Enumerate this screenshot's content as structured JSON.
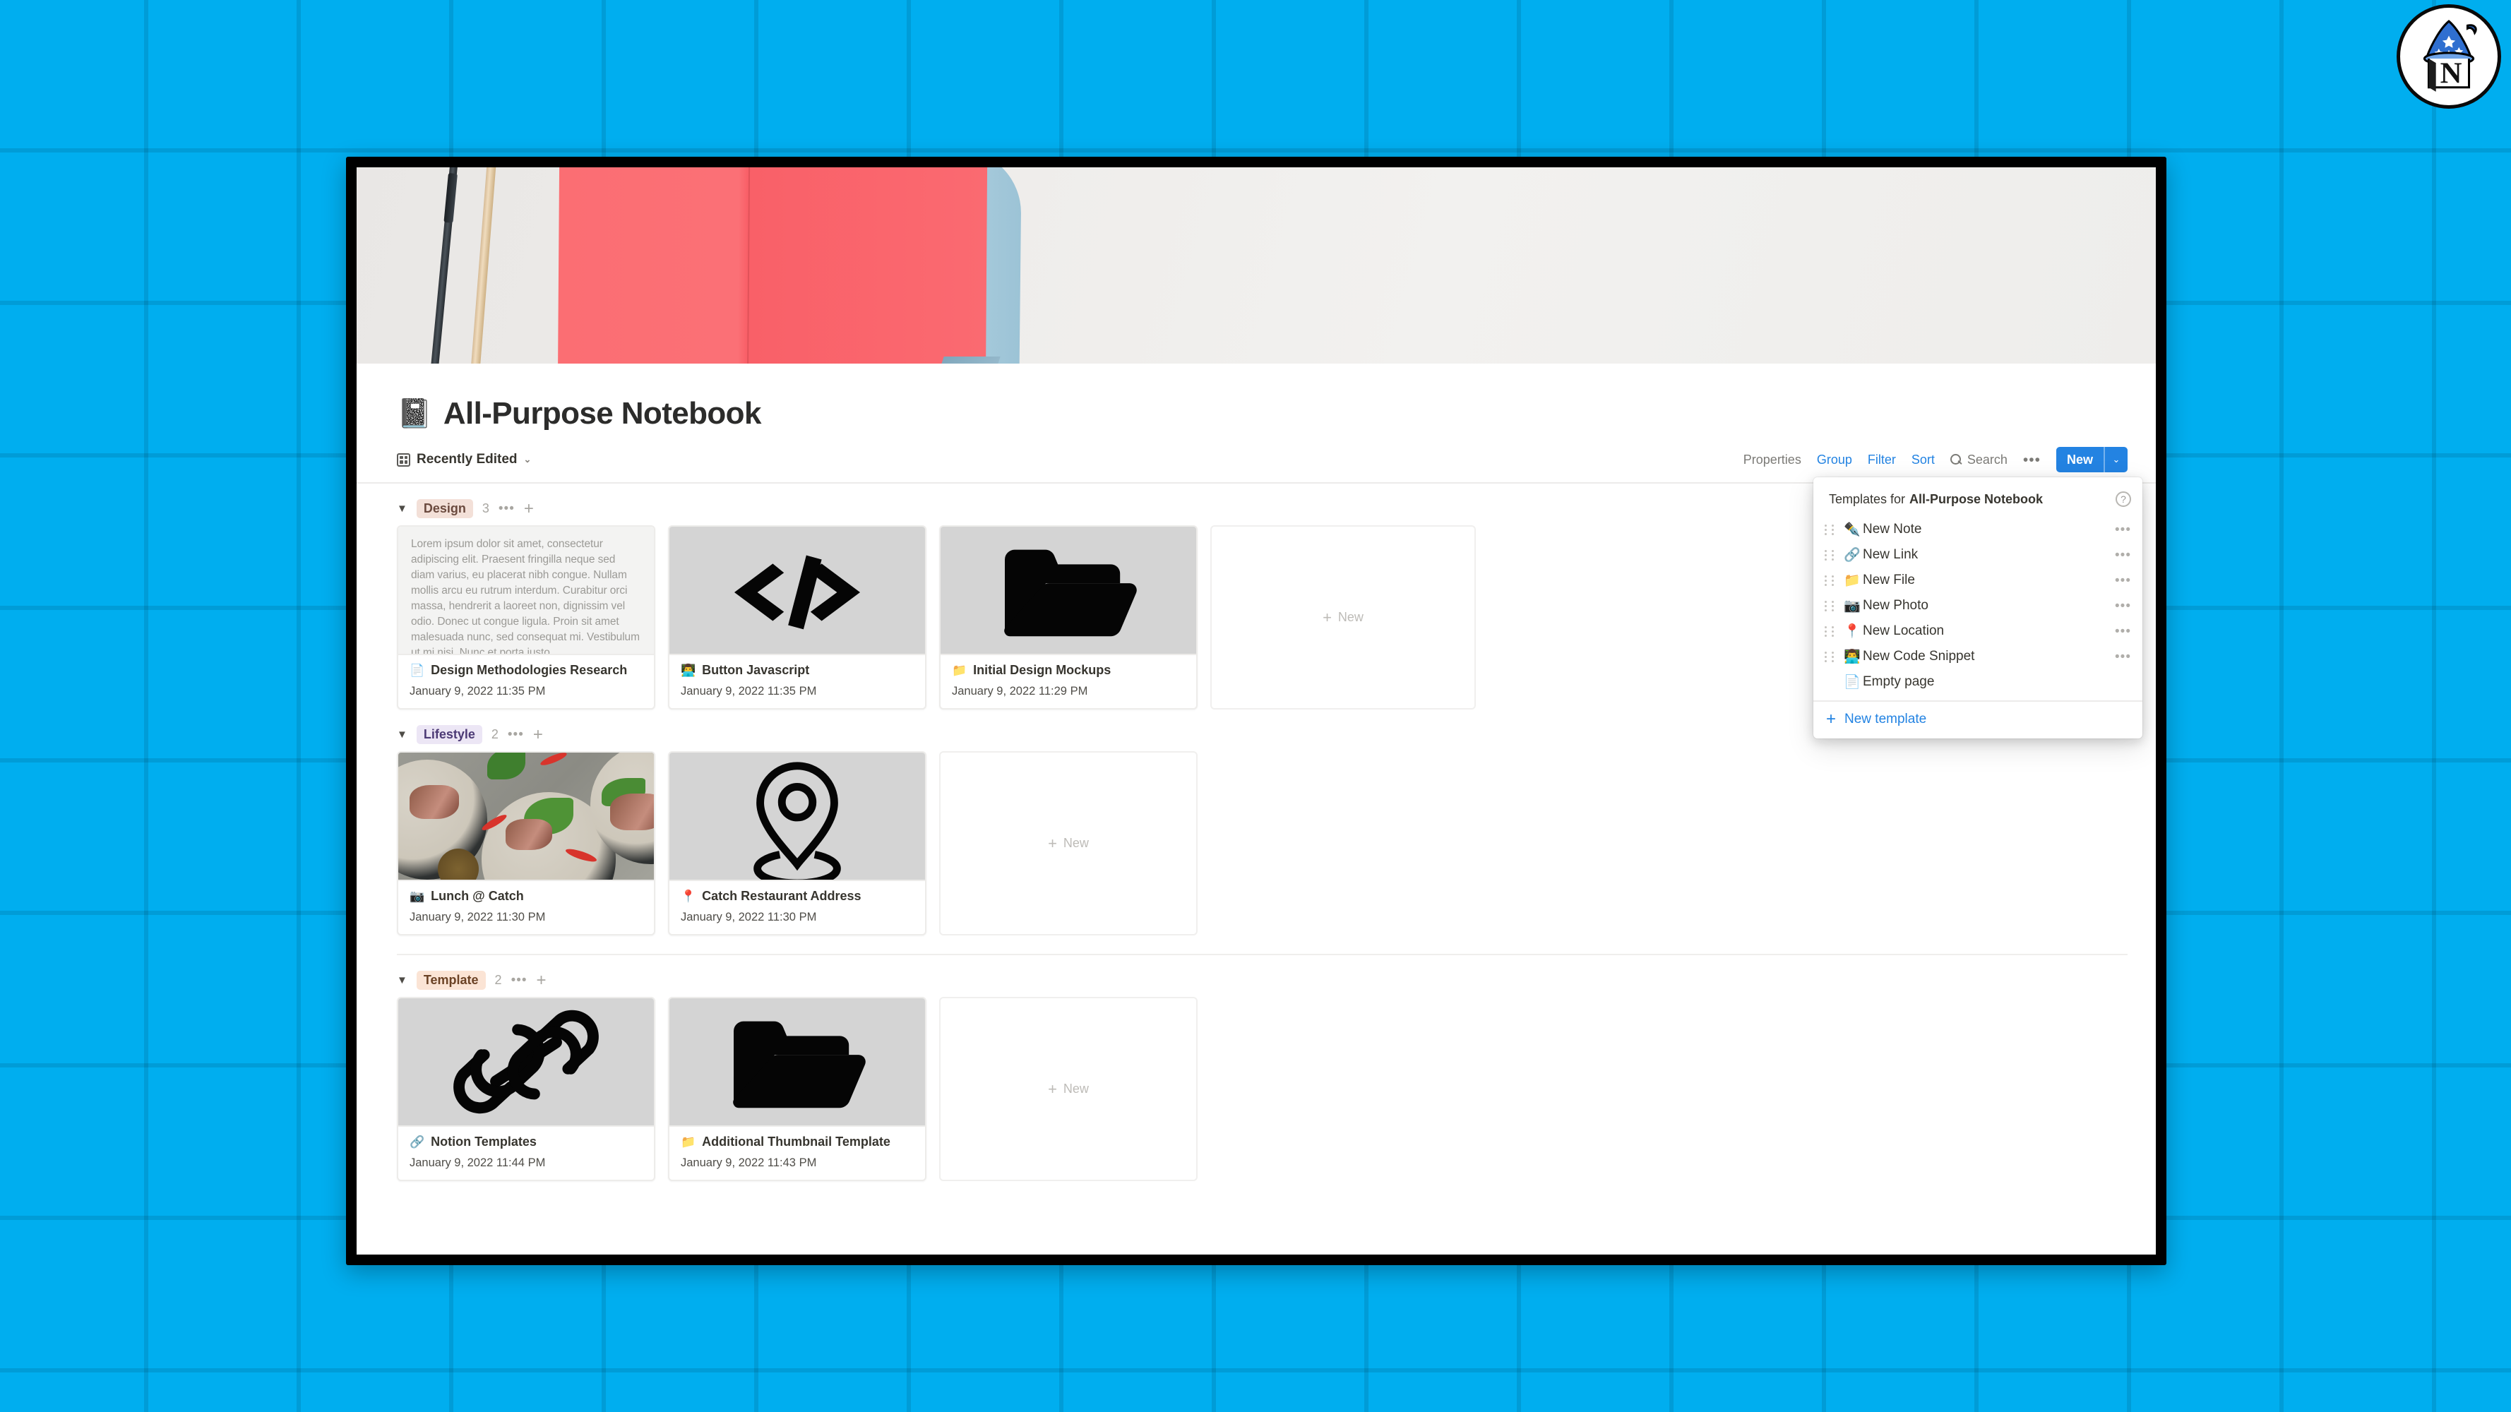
{
  "background": {
    "color": "#00AEEF",
    "grid_line_color": "rgba(0,0,0,0.10)"
  },
  "logo": {
    "name": "notion-wizard-logo",
    "letter": "N"
  },
  "cover": {
    "alt": "pink notebook with pen and pencil on light gray desk"
  },
  "page": {
    "emoji": "📓",
    "title": "All-Purpose Notebook"
  },
  "view_bar": {
    "current_view": "Recently Edited",
    "view_caret": "⌄",
    "actions": {
      "properties": "Properties",
      "group": "Group",
      "filter": "Filter",
      "sort": "Sort",
      "search": "Search",
      "more": "•••",
      "new_button": "New",
      "new_caret": "⌄"
    },
    "accent_color": "#2383e2"
  },
  "groups": [
    {
      "name": "Design",
      "count": "3",
      "chip_bg": "#f3e0d8",
      "chip_fg": "#6b4a3e",
      "caret": "▼",
      "dots": "•••",
      "plus": "+",
      "new_card_label": "New",
      "cards": [
        {
          "thumb": "text-preview",
          "preview_text": "Lorem ipsum dolor sit amet, consectetur adipiscing elit. Praesent fringilla neque sed diam varius, eu placerat nibh congue. Nullam mollis arcu eu rutrum interdum. Curabitur orci massa, hendrerit a laoreet non, dignissim vel odio. Donec ut congue ligula. Proin sit amet malesuada nunc, sed consequat mi. Vestibulum ut mi nisi. Nunc et porta justo.",
          "emoji": "📄",
          "title": "Design Methodologies Research",
          "date": "January 9, 2022 11:35 PM"
        },
        {
          "thumb": "code-icon",
          "emoji": "👨‍💻",
          "title": "Button Javascript",
          "date": "January 9, 2022 11:35 PM"
        },
        {
          "thumb": "folder-icon",
          "emoji": "📁",
          "title": "Initial Design Mockups",
          "date": "January 9, 2022 11:29 PM"
        }
      ]
    },
    {
      "name": "Lifestyle",
      "count": "2",
      "chip_bg": "#ece6f5",
      "chip_fg": "#4c3a75",
      "caret": "▼",
      "dots": "•••",
      "plus": "+",
      "new_card_label": "New",
      "cards": [
        {
          "thumb": "food-photo",
          "emoji": "📷",
          "title": "Lunch @ Catch",
          "date": "January 9, 2022 11:30 PM"
        },
        {
          "thumb": "pin-icon",
          "emoji": "📍",
          "title": "Catch Restaurant Address",
          "date": "January 9, 2022 11:30 PM"
        }
      ]
    },
    {
      "name": "Template",
      "count": "2",
      "chip_bg": "#fbe4d5",
      "chip_fg": "#6b4225",
      "caret": "▼",
      "dots": "•••",
      "plus": "+",
      "new_card_label": "New",
      "cards": [
        {
          "thumb": "link-icon",
          "emoji": "🔗",
          "title": "Notion Templates",
          "date": "January 9, 2022 11:44 PM"
        },
        {
          "thumb": "folder-icon",
          "emoji": "📁",
          "title": "Additional Thumbnail Template",
          "date": "January 9, 2022 11:43 PM"
        }
      ]
    }
  ],
  "templates_menu": {
    "header_prefix": "Templates for",
    "header_target": "All-Purpose Notebook",
    "help_glyph": "?",
    "items": [
      {
        "emoji": "✒️",
        "label": "New Note",
        "dots": "•••",
        "draggable": true
      },
      {
        "emoji": "🔗",
        "label": "New Link",
        "dots": "•••",
        "draggable": true
      },
      {
        "emoji": "📁",
        "label": "New File",
        "dots": "•••",
        "draggable": true
      },
      {
        "emoji": "📷",
        "label": "New Photo",
        "dots": "•••",
        "draggable": true
      },
      {
        "emoji": "📍",
        "label": "New Location",
        "dots": "•••",
        "draggable": true
      },
      {
        "emoji": "👨‍💻",
        "label": "New Code Snippet",
        "dots": "•••",
        "draggable": true
      },
      {
        "emoji": "📄",
        "label": "Empty page",
        "dots": "",
        "draggable": false
      }
    ],
    "new_template_plus": "+",
    "new_template_label": "New template"
  }
}
